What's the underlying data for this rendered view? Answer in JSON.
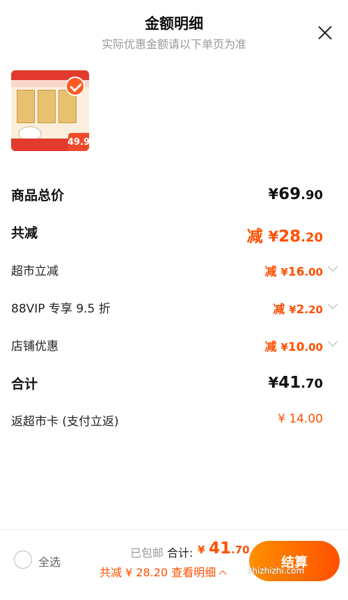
{
  "header": {
    "title": "金额明细",
    "subtitle": "实际优惠金额请以下单页为准"
  },
  "product": {
    "image_price": "49.9"
  },
  "rows": {
    "goods_total": {
      "label": "商品总价",
      "yen": "¥",
      "int": "69",
      "cents": ".90"
    },
    "total_reduction": {
      "label": "共减",
      "prefix": "减",
      "yen": "¥",
      "int": "28",
      "cents": ".20"
    },
    "supermarket_discount": {
      "label": "超市立减",
      "prefix": "减",
      "yen": "¥",
      "int": "16",
      "cents": ".00"
    },
    "vip_discount": {
      "label": "88VIP 专享 9.5 折",
      "prefix": "减",
      "yen": "¥",
      "int": "2",
      "cents": ".20"
    },
    "store_discount": {
      "label": "店铺优惠",
      "prefix": "减",
      "yen": "¥",
      "int": "10",
      "cents": ".00"
    },
    "subtotal": {
      "label": "合计",
      "yen": "¥",
      "int": "41",
      "cents": ".70"
    },
    "cashback": {
      "label": "返超市卡 (支付立返)",
      "value": "¥ 14.00"
    }
  },
  "footer": {
    "select_all": "全选",
    "shipping": "已包邮",
    "total_label": "合计:",
    "total_yen": "¥",
    "total_int": "41",
    "total_cents": ".70",
    "savings": "共减 ¥ 28.20  查看明细",
    "checkout": "结算",
    "watermark": "zhizhizhi.com"
  },
  "colors": {
    "accent": "#ff5000",
    "checkout_gradient_start": "#ff9000",
    "subtitle": "#999999"
  },
  "icons": [
    "close-icon",
    "check-icon",
    "chevron-down-icon",
    "chevron-up-icon",
    "radio-icon"
  ]
}
